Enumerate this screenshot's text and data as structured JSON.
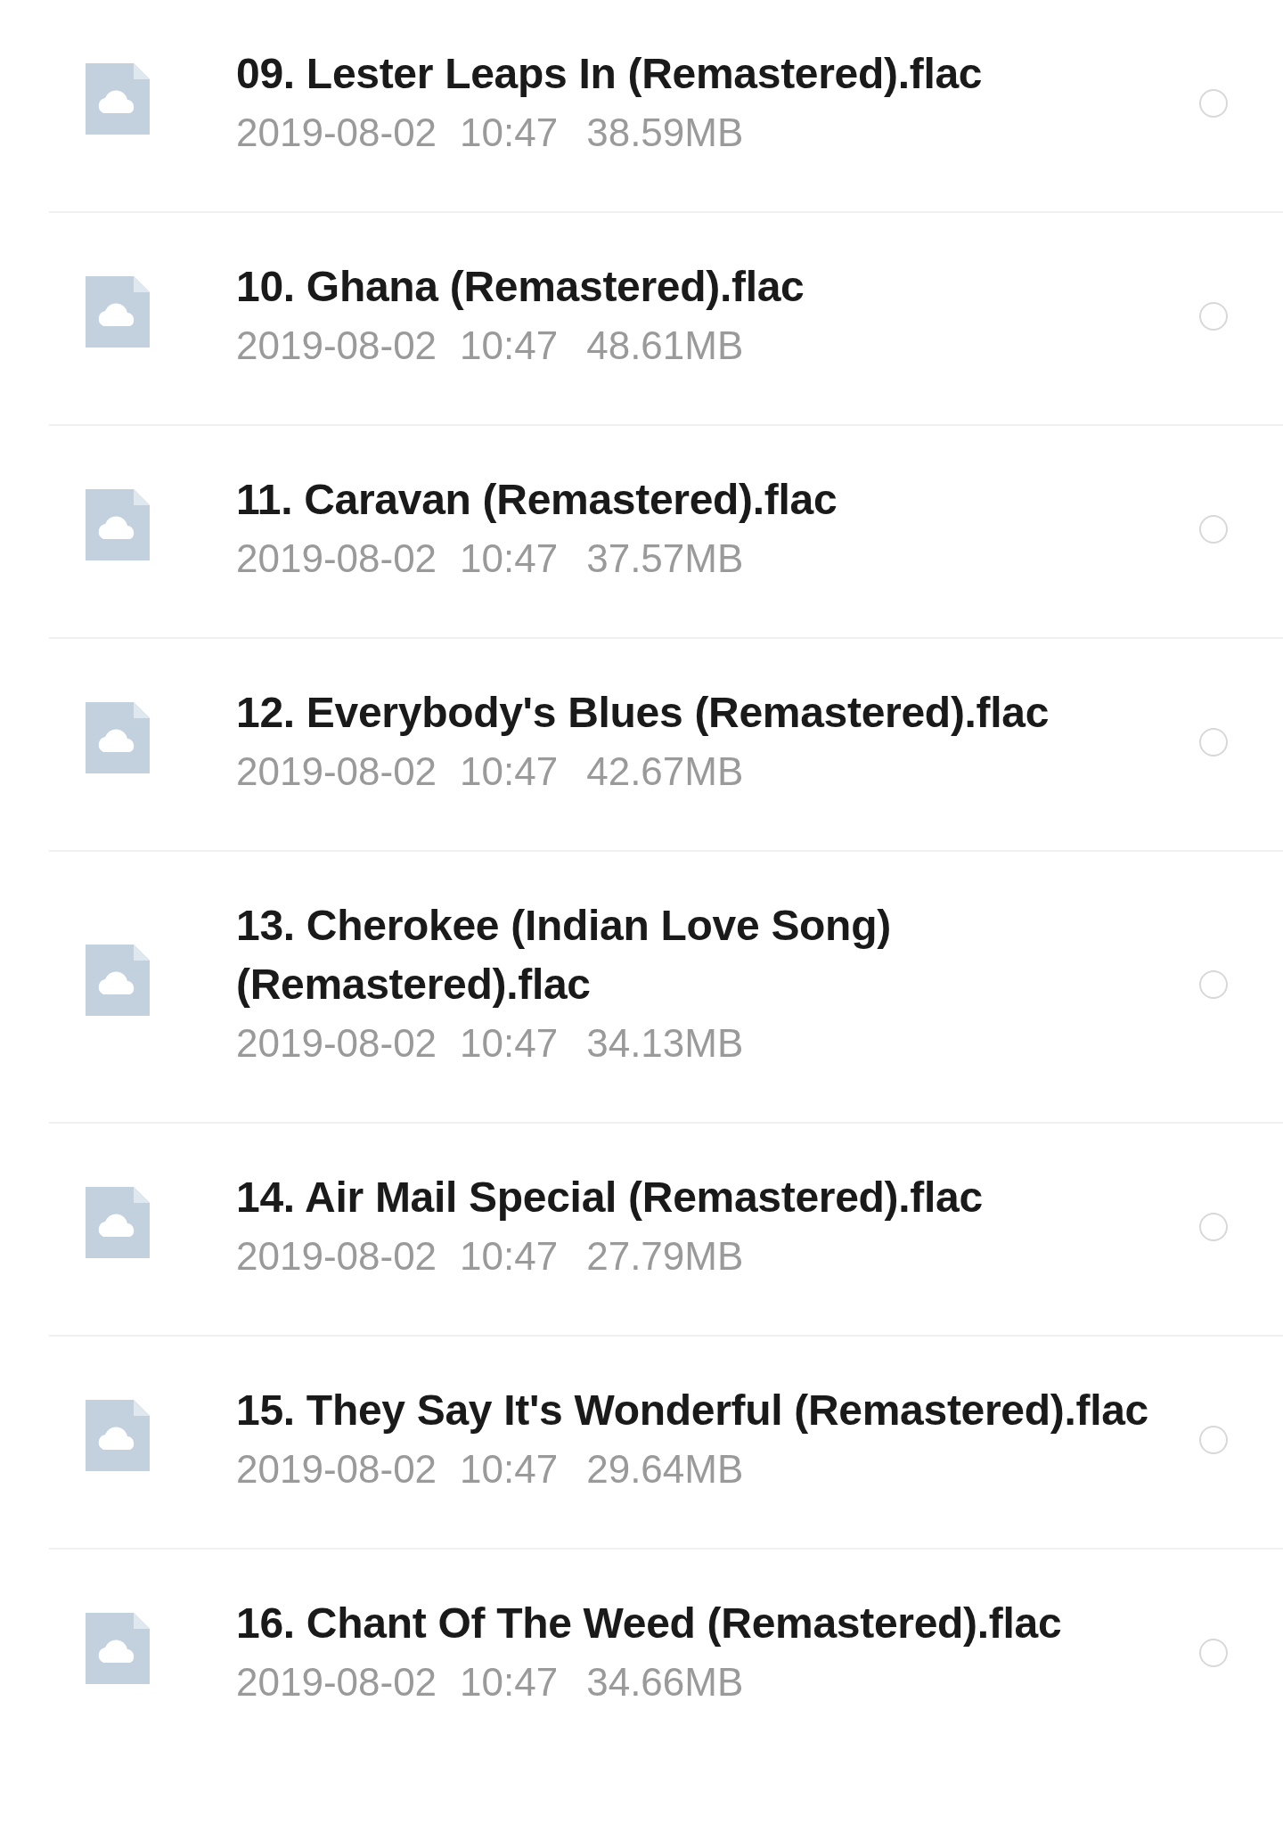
{
  "files": [
    {
      "name": "09. Lester Leaps In (Remastered).flac",
      "date": "2019-08-02",
      "time": "10:47",
      "size": "38.59MB",
      "selected": false
    },
    {
      "name": "10. Ghana (Remastered).flac",
      "date": "2019-08-02",
      "time": "10:47",
      "size": "48.61MB",
      "selected": false
    },
    {
      "name": "11. Caravan (Remastered).flac",
      "date": "2019-08-02",
      "time": "10:47",
      "size": "37.57MB",
      "selected": false
    },
    {
      "name": "12. Everybody's Blues (Remastered).flac",
      "date": "2019-08-02",
      "time": "10:47",
      "size": "42.67MB",
      "selected": false
    },
    {
      "name": "13. Cherokee (Indian Love Song) (Remastered).flac",
      "date": "2019-08-02",
      "time": "10:47",
      "size": "34.13MB",
      "selected": false
    },
    {
      "name": "14. Air Mail Special (Remastered).flac",
      "date": "2019-08-02",
      "time": "10:47",
      "size": "27.79MB",
      "selected": false
    },
    {
      "name": "15. They Say It's Wonderful (Remastered).flac",
      "date": "2019-08-02",
      "time": "10:47",
      "size": "29.64MB",
      "selected": false
    },
    {
      "name": "16. Chant Of The Weed (Remastered).flac",
      "date": "2019-08-02",
      "time": "10:47",
      "size": "34.66MB",
      "selected": false
    }
  ]
}
